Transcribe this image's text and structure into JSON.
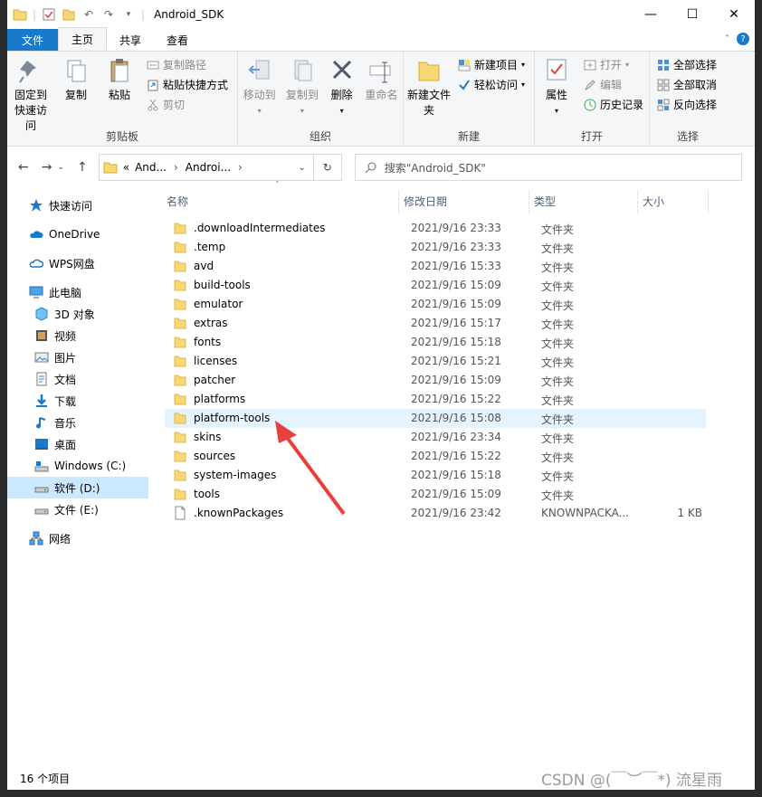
{
  "window": {
    "title": "Android_SDK",
    "controls": {
      "minimize": "—",
      "maximize": "☐",
      "close": "✕"
    }
  },
  "ribbon_tabs": {
    "file": "文件",
    "home": "主页",
    "share": "共享",
    "view": "查看"
  },
  "ribbon": {
    "clipboard": {
      "label": "剪贴板",
      "pin": "固定到快速访问",
      "copy": "复制",
      "paste": "粘贴",
      "copy_path": "复制路径",
      "paste_shortcut": "粘贴快捷方式",
      "cut": "剪切"
    },
    "organize": {
      "label": "组织",
      "move_to": "移动到",
      "copy_to": "复制到",
      "delete": "删除",
      "rename": "重命名"
    },
    "new": {
      "label": "新建",
      "new_folder": "新建文件夹",
      "new_item": "新建项目",
      "easy_access": "轻松访问"
    },
    "open": {
      "label": "打开",
      "properties": "属性",
      "open": "打开",
      "edit": "编辑",
      "history": "历史记录"
    },
    "select": {
      "label": "选择",
      "select_all": "全部选择",
      "select_none": "全部取消",
      "invert": "反向选择"
    }
  },
  "address": {
    "crumb_prefix": "«",
    "crumb1": "And...",
    "crumb2": "Androi...",
    "search_placeholder": "搜索\"Android_SDK\""
  },
  "sidebar": {
    "items": [
      "快速访问",
      "OneDrive",
      "WPS网盘",
      "此电脑",
      "3D 对象",
      "视频",
      "图片",
      "文档",
      "下载",
      "音乐",
      "桌面",
      "Windows (C:)",
      "软件 (D:)",
      "文件 (E:)",
      "网络"
    ]
  },
  "columns": {
    "name": "名称",
    "modified": "修改日期",
    "type": "类型",
    "size": "大小"
  },
  "files": [
    {
      "name": ".downloadIntermediates",
      "date": "2021/9/16 23:33",
      "type": "文件夹",
      "size": ""
    },
    {
      "name": ".temp",
      "date": "2021/9/16 23:33",
      "type": "文件夹",
      "size": ""
    },
    {
      "name": "avd",
      "date": "2021/9/16 15:33",
      "type": "文件夹",
      "size": ""
    },
    {
      "name": "build-tools",
      "date": "2021/9/16 15:09",
      "type": "文件夹",
      "size": ""
    },
    {
      "name": "emulator",
      "date": "2021/9/16 15:09",
      "type": "文件夹",
      "size": ""
    },
    {
      "name": "extras",
      "date": "2021/9/16 15:17",
      "type": "文件夹",
      "size": ""
    },
    {
      "name": "fonts",
      "date": "2021/9/16 15:18",
      "type": "文件夹",
      "size": ""
    },
    {
      "name": "licenses",
      "date": "2021/9/16 15:21",
      "type": "文件夹",
      "size": ""
    },
    {
      "name": "patcher",
      "date": "2021/9/16 15:09",
      "type": "文件夹",
      "size": ""
    },
    {
      "name": "platforms",
      "date": "2021/9/16 15:22",
      "type": "文件夹",
      "size": ""
    },
    {
      "name": "platform-tools",
      "date": "2021/9/16 15:08",
      "type": "文件夹",
      "size": ""
    },
    {
      "name": "skins",
      "date": "2021/9/16 23:34",
      "type": "文件夹",
      "size": ""
    },
    {
      "name": "sources",
      "date": "2021/9/16 15:22",
      "type": "文件夹",
      "size": ""
    },
    {
      "name": "system-images",
      "date": "2021/9/16 15:18",
      "type": "文件夹",
      "size": ""
    },
    {
      "name": "tools",
      "date": "2021/9/16 15:09",
      "type": "文件夹",
      "size": ""
    },
    {
      "name": ".knownPackages",
      "date": "2021/9/16 23:42",
      "type": "KNOWNPACKA...",
      "size": "1 KB"
    }
  ],
  "status": {
    "count": "16 个项目"
  },
  "watermark": "CSDN @(￣︶￣*) 流星雨",
  "colors": {
    "accent": "#1979ca",
    "folder": "#f8d775",
    "arrow": "#e8413c",
    "selection": "#cce8ff",
    "hover": "#e5f3ff"
  }
}
